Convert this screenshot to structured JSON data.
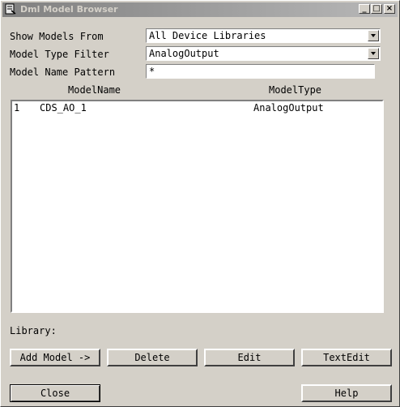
{
  "window": {
    "title": "Dml Model Browser"
  },
  "form": {
    "show_models_label": "Show Models From",
    "show_models_value": "All Device Libraries",
    "type_filter_label": "Model Type Filter",
    "type_filter_value": "AnalogOutput",
    "name_pattern_label": "Model Name Pattern",
    "name_pattern_value": "*"
  },
  "table": {
    "columns": [
      "ModelName",
      "ModelType"
    ],
    "rows": [
      {
        "index": "1",
        "name": "CDS_AO_1",
        "type": "AnalogOutput"
      }
    ]
  },
  "library_label": "Library:",
  "buttons": {
    "add_model": "Add Model ->",
    "delete": "Delete",
    "edit": "Edit",
    "textedit": "TextEdit",
    "close": "Close",
    "help": "Help"
  }
}
